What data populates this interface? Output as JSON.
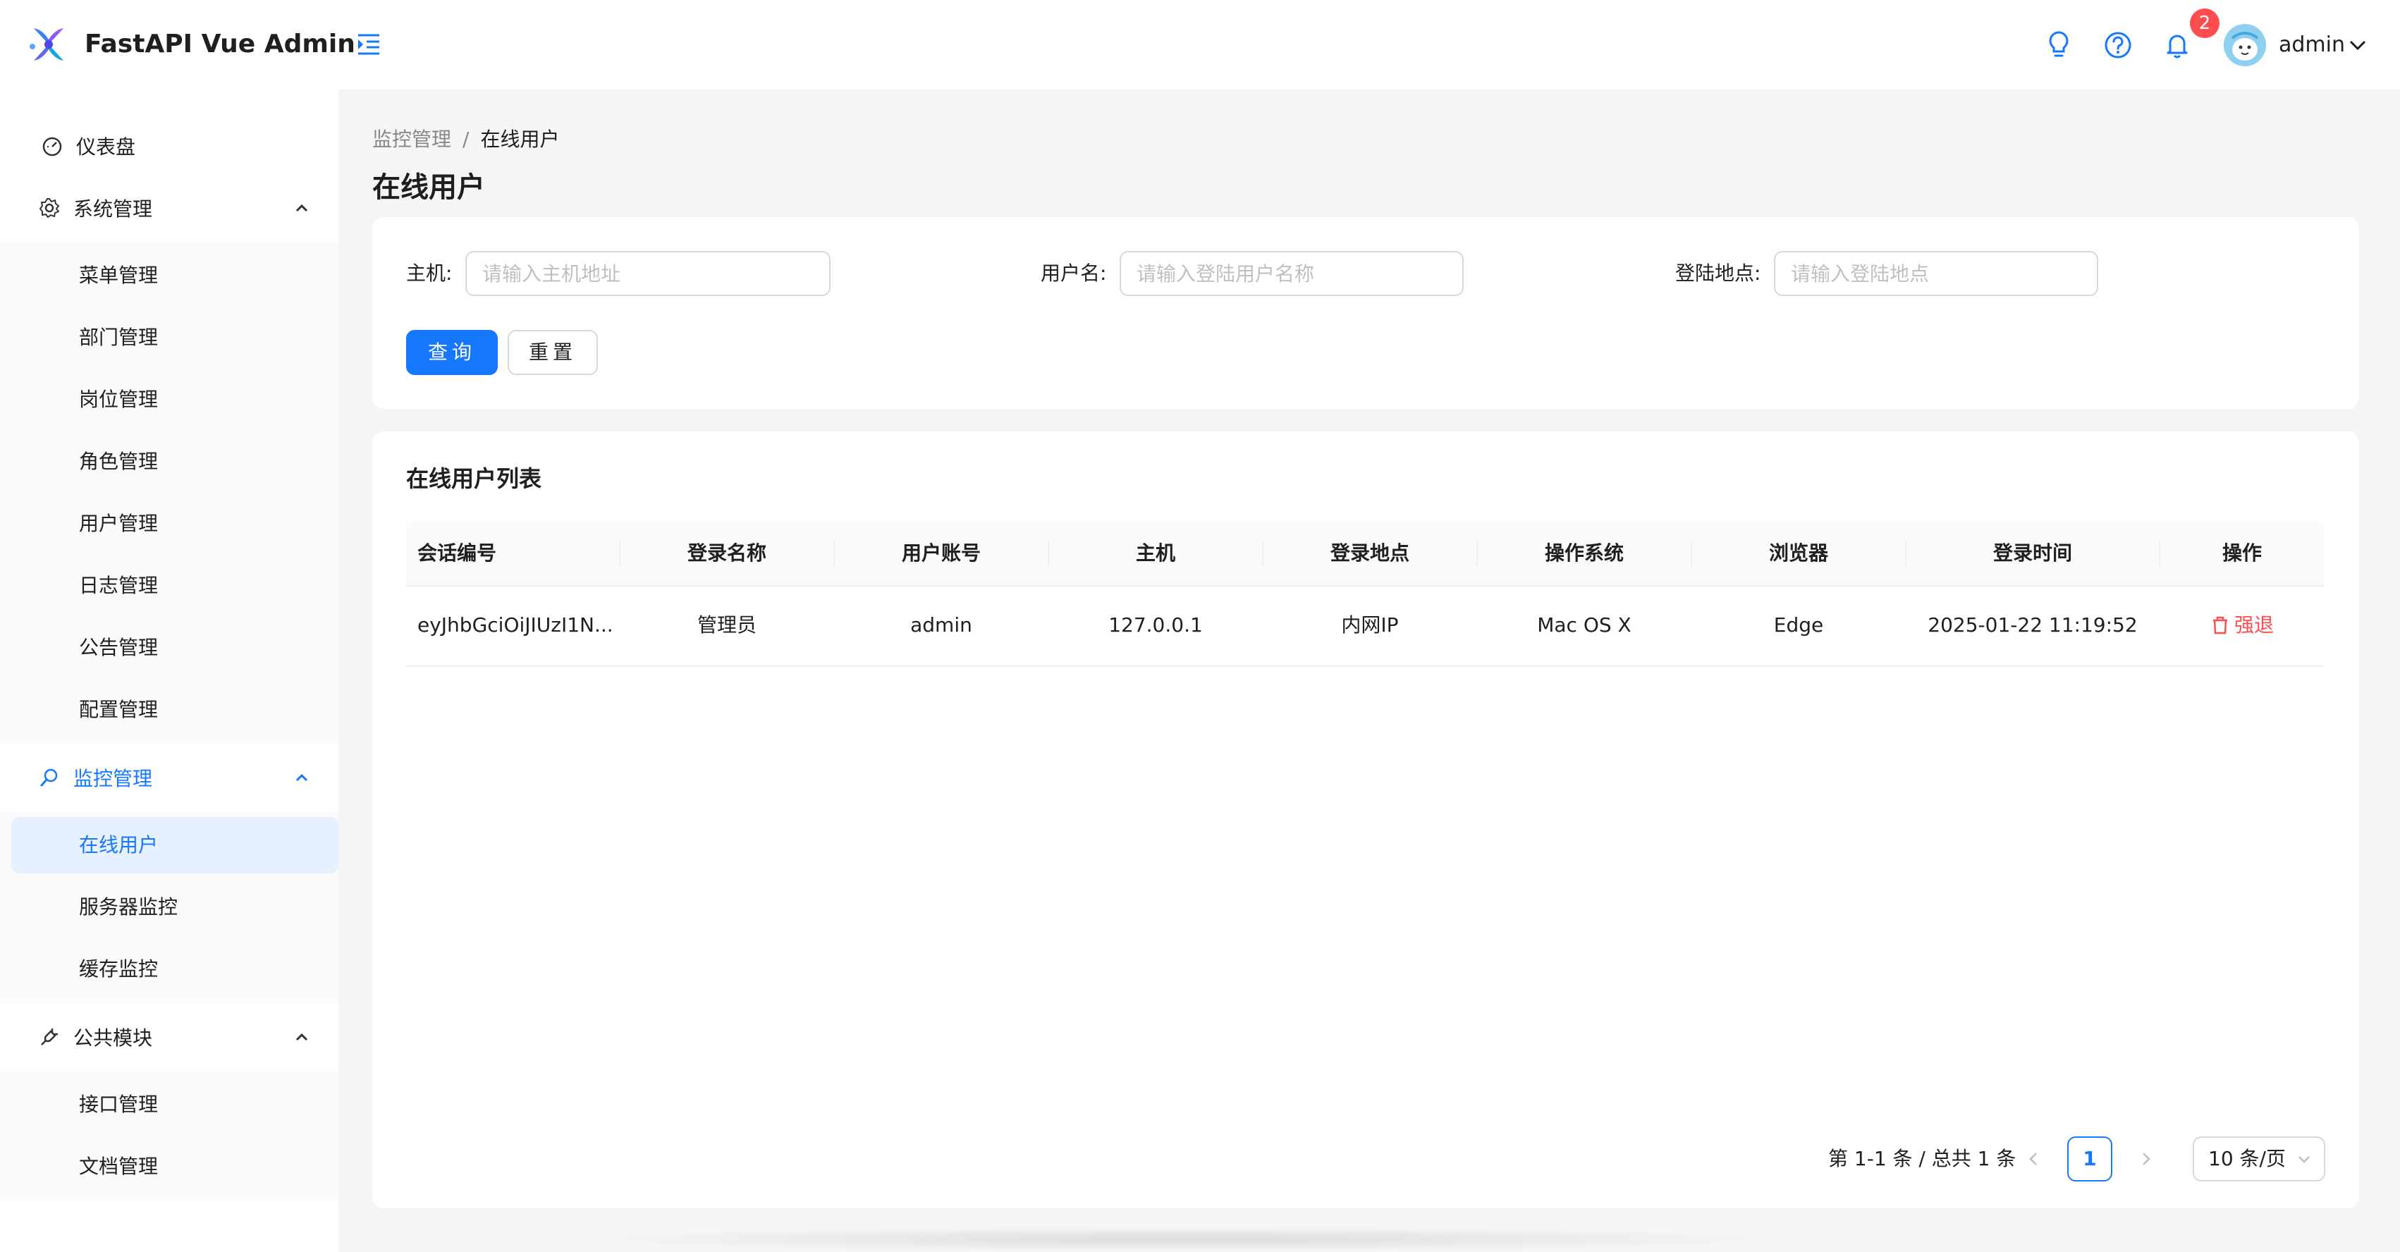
{
  "header": {
    "app_title": "FastAPI Vue Admin",
    "notification_count": "2",
    "user_name": "admin"
  },
  "sidebar": {
    "dashboard": "仪表盘",
    "system": {
      "label": "系统管理",
      "items": [
        "菜单管理",
        "部门管理",
        "岗位管理",
        "角色管理",
        "用户管理",
        "日志管理",
        "公告管理",
        "配置管理"
      ]
    },
    "monitor": {
      "label": "监控管理",
      "items": [
        "在线用户",
        "服务器监控",
        "缓存监控"
      ]
    },
    "public": {
      "label": "公共模块",
      "items": [
        "接口管理",
        "文档管理"
      ]
    }
  },
  "breadcrumb": {
    "parent": "监控管理",
    "separator": "/",
    "current": "在线用户"
  },
  "page_title": "在线用户",
  "search": {
    "host_label": "主机:",
    "host_placeholder": "请输入主机地址",
    "username_label": "用户名:",
    "username_placeholder": "请输入登陆用户名称",
    "location_label": "登陆地点:",
    "location_placeholder": "请输入登陆地点",
    "query_button": "查询",
    "reset_button": "重置"
  },
  "table": {
    "title": "在线用户列表",
    "columns": [
      "会话编号",
      "登录名称",
      "用户账号",
      "主机",
      "登录地点",
      "操作系统",
      "浏览器",
      "登录时间",
      "操作"
    ],
    "rows": [
      {
        "session_id": "eyJhbGciOiJIUzI1N...",
        "login_name": "管理员",
        "account": "admin",
        "host": "127.0.0.1",
        "location": "内网IP",
        "os": "Mac OS X",
        "browser": "Edge",
        "login_time": "2025-01-22 11:19:52",
        "action": "强退"
      }
    ]
  },
  "pagination": {
    "total_text": "第 1-1 条 / 总共 1 条",
    "current_page": "1",
    "page_size": "10 条/页"
  },
  "colors": {
    "primary": "#1677ff",
    "danger": "#ff4d4f",
    "badge": "#ff4d4f"
  }
}
